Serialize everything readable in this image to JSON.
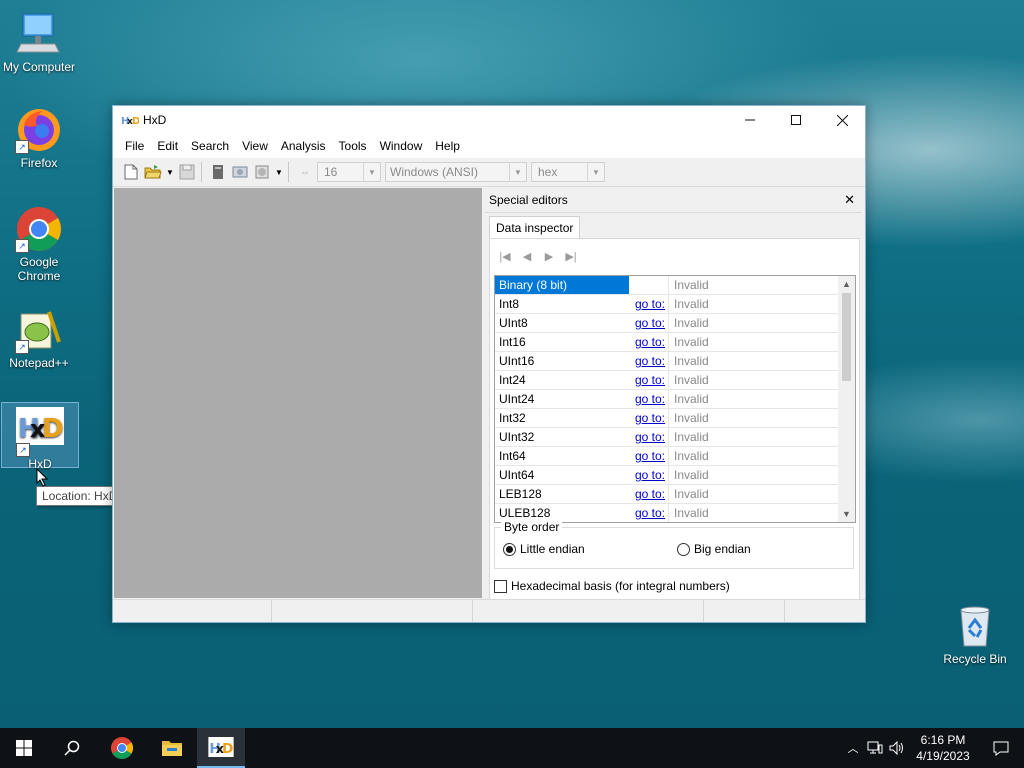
{
  "desktop": {
    "icons": [
      {
        "label": "My Computer"
      },
      {
        "label": "Firefox"
      },
      {
        "label": "Google Chrome"
      },
      {
        "label": "Notepad++"
      },
      {
        "label": "HxD"
      },
      {
        "label": "Recycle Bin"
      }
    ],
    "tooltip": "Location: HxD (C:\\Program Files\\HxD)"
  },
  "window": {
    "title": "HxD",
    "menu": [
      "File",
      "Edit",
      "Search",
      "View",
      "Analysis",
      "Tools",
      "Window",
      "Help"
    ],
    "toolbar": {
      "bytes_per_row": "16",
      "charset": "Windows (ANSI)",
      "offset_base": "hex"
    },
    "special_editors": {
      "title": "Special editors",
      "tab": "Data inspector",
      "rows": [
        {
          "type": "Binary (8 bit)",
          "goto": "",
          "value": "Invalid"
        },
        {
          "type": "Int8",
          "goto": "go to:",
          "value": "Invalid"
        },
        {
          "type": "UInt8",
          "goto": "go to:",
          "value": "Invalid"
        },
        {
          "type": "Int16",
          "goto": "go to:",
          "value": "Invalid"
        },
        {
          "type": "UInt16",
          "goto": "go to:",
          "value": "Invalid"
        },
        {
          "type": "Int24",
          "goto": "go to:",
          "value": "Invalid"
        },
        {
          "type": "UInt24",
          "goto": "go to:",
          "value": "Invalid"
        },
        {
          "type": "Int32",
          "goto": "go to:",
          "value": "Invalid"
        },
        {
          "type": "UInt32",
          "goto": "go to:",
          "value": "Invalid"
        },
        {
          "type": "Int64",
          "goto": "go to:",
          "value": "Invalid"
        },
        {
          "type": "UInt64",
          "goto": "go to:",
          "value": "Invalid"
        },
        {
          "type": "LEB128",
          "goto": "go to:",
          "value": "Invalid"
        },
        {
          "type": "ULEB128",
          "goto": "go to:",
          "value": "Invalid"
        }
      ],
      "byte_order": {
        "label": "Byte order",
        "little": "Little endian",
        "big": "Big endian",
        "selected": "little"
      },
      "hex_basis": "Hexadecimal basis (for integral numbers)"
    }
  },
  "taskbar": {
    "time": "6:16 PM",
    "date": "4/19/2023"
  },
  "colors": {
    "selection": "#0078d7",
    "link": "#0000cc",
    "editor_bg": "#ababab"
  }
}
